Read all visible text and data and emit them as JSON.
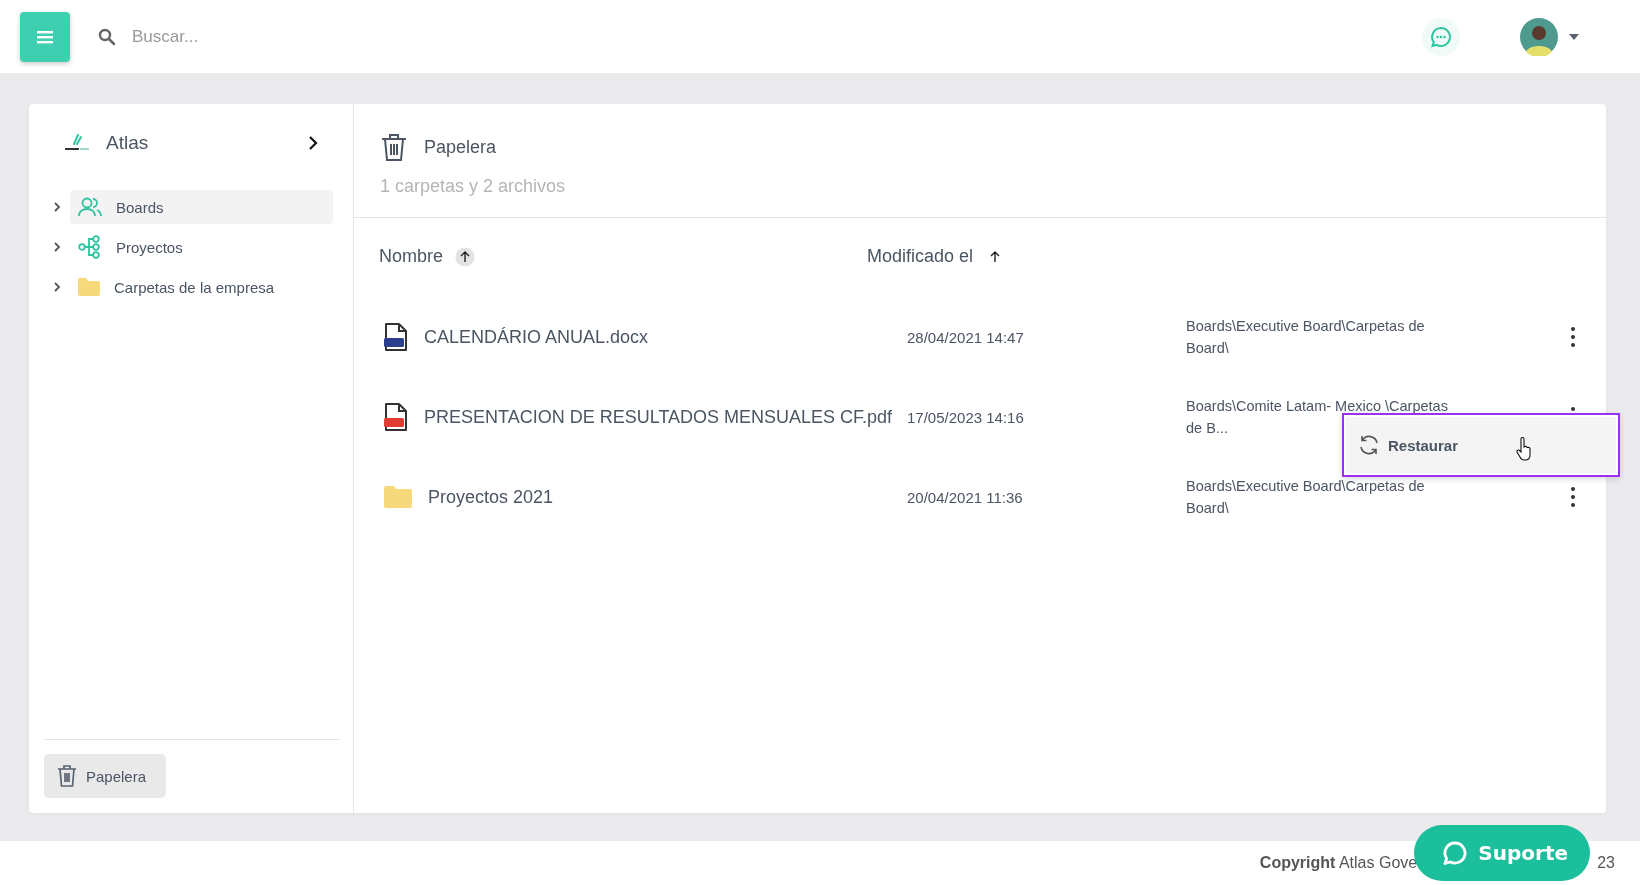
{
  "header": {
    "search": {
      "placeholder": "Buscar..."
    }
  },
  "sidebar": {
    "workspace": "Atlas",
    "tree": [
      {
        "label": "Boards",
        "kind": "users",
        "selected": true,
        "expanded": false
      },
      {
        "label": "Proyectos",
        "kind": "network",
        "selected": false,
        "expanded": false
      },
      {
        "label": "Carpetas de la empresa",
        "kind": "folder",
        "selected": false,
        "expanded": false
      }
    ],
    "trash_button": "Papelera"
  },
  "content": {
    "title": "Papelera",
    "subtitle": "1 carpetas y 2 archivos",
    "columns": [
      {
        "label": "Nombre",
        "ascending": true,
        "boxed": true
      },
      {
        "label": "Modificado el",
        "ascending": true,
        "boxed": false
      }
    ],
    "rows": [
      {
        "kind": "doc",
        "name": "CALENDÁRIO ANUAL.docx",
        "modified": "28/04/2021 14:47",
        "path": "Boards\\Executive Board\\Carpetas de Board\\"
      },
      {
        "kind": "pdf",
        "name": "PRESENTACION DE RESULTADOS MENSUALES CF.pdf",
        "modified": "17/05/2023 14:16",
        "path": "Boards\\Comite Latam- Mexico \\Carpetas de B...",
        "menu_open": true
      },
      {
        "kind": "folder",
        "name": "Proyectos 2021",
        "modified": "20/04/2021 11:36",
        "path": "Boards\\Executive Board\\Carpetas de Board\\"
      }
    ],
    "context_menu": {
      "items": [
        {
          "label": "Restaurar",
          "hovered": true
        }
      ]
    }
  },
  "footer": {
    "copyright": "**Copyright** Atlas Gove",
    "tail": "23"
  },
  "support_button": "Suporte"
}
